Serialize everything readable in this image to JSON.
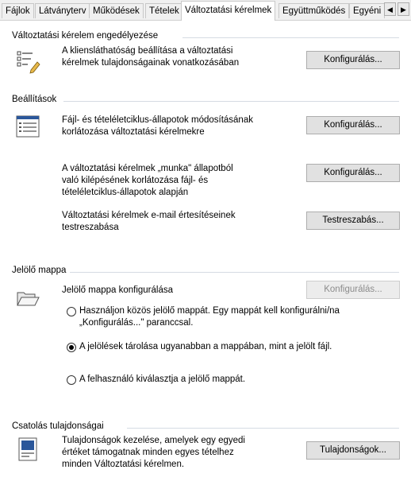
{
  "tabs": [
    {
      "label": "Fájlok"
    },
    {
      "label": "Látványterv"
    },
    {
      "label": "Működések"
    },
    {
      "label": "Tételek"
    },
    {
      "label": "Változtatási kérelmek"
    },
    {
      "label": "Együttműködés"
    },
    {
      "label": "Egyéni"
    }
  ],
  "tab_scroll": {
    "left": "◀",
    "right": "▶"
  },
  "client_visibility": {
    "title": "Változtatási kérelem engedélyezése",
    "desc_line1": "A kliensláthatóság beállítása a változtatási",
    "desc_line2": "kérelmek tulajdonságainak vonatkozásában",
    "button": "Konfigurálás..."
  },
  "settings": {
    "title": "Beállítások",
    "item1_line1": "Fájl- és tételéletciklus-állapotok módosításának",
    "item1_line2": "korlátozása változtatási kérelmekre",
    "item1_button": "Konfigurálás...",
    "item2_line1": "A változtatási kérelmek „munka\" állapotból",
    "item2_line2": "való kilépésének korlátozása fájl- és",
    "item2_line3": "tételéletciklus-állapotok alapján",
    "item2_button": "Konfigurálás...",
    "item3_line1": "Változtatási kérelmek e-mail értesítéseinek",
    "item3_line2": "testreszabása",
    "item3_button": "Testreszabás..."
  },
  "markup_folder": {
    "title": "Jelölő mappa",
    "desc": "Jelölő mappa konfigurálása",
    "button": "Konfigurálás...",
    "option1_line1": "Használjon közös jelölő mappát. Egy mappát kell konfigurálni/na",
    "option1_line2": "„Konfigurálás...\" paranccsal.",
    "option2": "A jelölések tárolása ugyanabban a mappában, mint a jelölt fájl.",
    "option3": "A felhasználó kiválasztja a jelölő mappát.",
    "selected_option": 2
  },
  "attachment_properties": {
    "title": "Csatolás tulajdonságai",
    "desc_line1": "Tulajdonságok kezelése, amelyek egy egyedi",
    "desc_line2": "értéket támogatnak minden egyes tételhez",
    "desc_line3": "minden Változtatási kérelmen.",
    "button": "Tulajdonságok..."
  },
  "colors": {
    "accent_blue": "#2b579a",
    "rule": "#d5dbe3",
    "button_bg": "#e1e1e1"
  }
}
